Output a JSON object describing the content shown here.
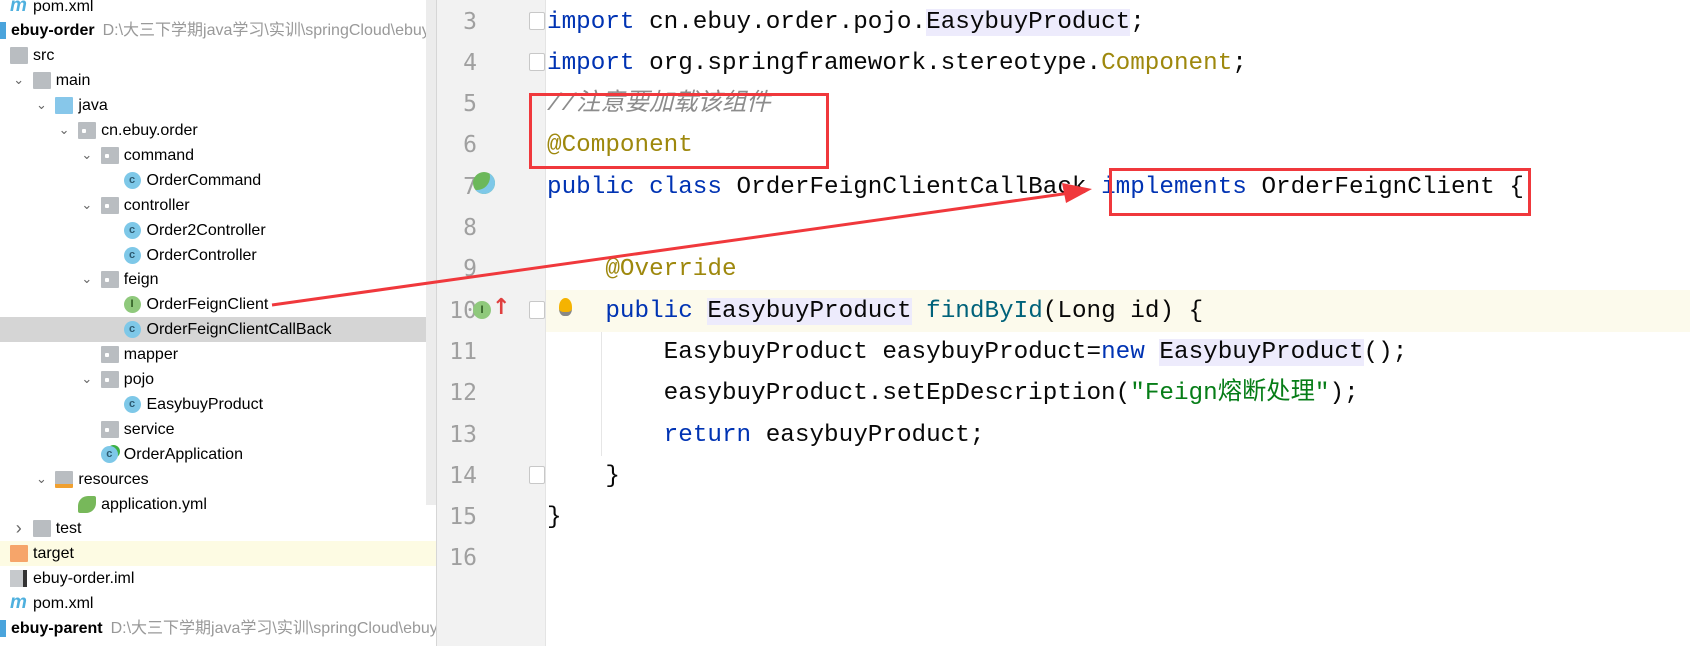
{
  "tree": [
    {
      "label": "pom.xml",
      "icon": "maven-icon",
      "depth": 1
    },
    {
      "label": "ebuy-order",
      "path": "D:\\大三下学期java学习\\实训\\springCloud\\ebuy\\",
      "icon": "module-icon",
      "depth": 0,
      "bold": true
    },
    {
      "label": "src",
      "icon": "folder-icon",
      "depth": 1
    },
    {
      "label": "main",
      "icon": "folder-icon",
      "depth": 2,
      "expanded": true
    },
    {
      "label": "java",
      "icon": "source-folder-icon",
      "depth": 3,
      "expanded": true
    },
    {
      "label": "cn.ebuy.order",
      "icon": "package-icon",
      "depth": 4,
      "expanded": true
    },
    {
      "label": "command",
      "icon": "package-icon",
      "depth": 5,
      "expanded": true
    },
    {
      "label": "OrderCommand",
      "icon": "class-icon",
      "depth": 6
    },
    {
      "label": "controller",
      "icon": "package-icon",
      "depth": 5,
      "expanded": true
    },
    {
      "label": "Order2Controller",
      "icon": "class-icon",
      "depth": 6
    },
    {
      "label": "OrderController",
      "icon": "class-icon",
      "depth": 6
    },
    {
      "label": "feign",
      "icon": "package-icon",
      "depth": 5,
      "expanded": true
    },
    {
      "label": "OrderFeignClient",
      "icon": "interface-icon",
      "depth": 6
    },
    {
      "label": "OrderFeignClientCallBack",
      "icon": "class-icon",
      "depth": 6,
      "selected": true
    },
    {
      "label": "mapper",
      "icon": "package-icon",
      "depth": 5
    },
    {
      "label": "pojo",
      "icon": "package-icon",
      "depth": 5,
      "expanded": true
    },
    {
      "label": "EasybuyProduct",
      "icon": "class-icon",
      "depth": 6
    },
    {
      "label": "service",
      "icon": "package-icon",
      "depth": 5
    },
    {
      "label": "OrderApplication",
      "icon": "spring-boot-class-icon",
      "depth": 5
    },
    {
      "label": "resources",
      "icon": "resources-folder-icon",
      "depth": 3,
      "expanded": true
    },
    {
      "label": "application.yml",
      "icon": "spring-yml-icon",
      "depth": 4
    },
    {
      "label": "test",
      "icon": "folder-icon",
      "depth": 2,
      "expanded": false
    },
    {
      "label": "target",
      "icon": "excluded-folder-icon",
      "depth": 1,
      "excluded": true
    },
    {
      "label": "ebuy-order.iml",
      "icon": "iml-file-icon",
      "depth": 1
    },
    {
      "label": "pom.xml",
      "icon": "maven-icon",
      "depth": 1
    },
    {
      "label": "ebuy-parent",
      "path": "D:\\大三下学期java学习\\实训\\springCloud\\ebuy",
      "icon": "module-icon",
      "depth": 0,
      "bold": true
    }
  ],
  "editor": {
    "current_line": "10",
    "lines": [
      {
        "num": "3",
        "tokens": [
          [
            "import",
            "kw"
          ],
          [
            " cn.ebuy.order.pojo.",
            ""
          ],
          [
            "EasybuyProduct",
            "hl"
          ],
          [
            ";",
            ""
          ]
        ]
      },
      {
        "num": "4",
        "tokens": [
          [
            "import",
            "kw"
          ],
          [
            " org.springframework.stereotype.",
            ""
          ],
          [
            "Component",
            "ann"
          ],
          [
            ";",
            ""
          ]
        ]
      },
      {
        "num": "5",
        "tokens": [
          [
            "//注意要加载该组件",
            "cmt"
          ]
        ]
      },
      {
        "num": "6",
        "tokens": [
          [
            "@Component",
            "ann"
          ]
        ]
      },
      {
        "num": "7",
        "tokens": [
          [
            "public class",
            "kw"
          ],
          [
            " OrderFeignClientCallBack ",
            ""
          ],
          [
            "implements",
            "kw"
          ],
          [
            " OrderFeignClient {",
            ""
          ]
        ]
      },
      {
        "num": "8",
        "tokens": []
      },
      {
        "num": "9",
        "tokens": [
          [
            "    ",
            ""
          ],
          [
            "@Override",
            "ann"
          ]
        ]
      },
      {
        "num": "10",
        "tokens": [
          [
            "    ",
            ""
          ],
          [
            "public",
            "kw"
          ],
          [
            " ",
            ""
          ],
          [
            "EasybuyProduct",
            "hl"
          ],
          [
            " ",
            ""
          ],
          [
            "findById",
            "fn"
          ],
          [
            "(Long id) {",
            ""
          ]
        ]
      },
      {
        "num": "11",
        "tokens": [
          [
            "        EasybuyProduct easybuyProduct=",
            ""
          ],
          [
            "new",
            "kw"
          ],
          [
            " ",
            ""
          ],
          [
            "EasybuyProduct",
            "hl"
          ],
          [
            "();",
            ""
          ]
        ]
      },
      {
        "num": "12",
        "tokens": [
          [
            "        easybuyProduct.setEpDescription(",
            ""
          ],
          [
            "\"Feign熔断处理\"",
            "str"
          ],
          [
            ");",
            ""
          ]
        ]
      },
      {
        "num": "13",
        "tokens": [
          [
            "        ",
            ""
          ],
          [
            "return",
            "kw"
          ],
          [
            " easybuyProduct;",
            ""
          ]
        ]
      },
      {
        "num": "14",
        "tokens": [
          [
            "    }",
            ""
          ]
        ]
      },
      {
        "num": "15",
        "tokens": [
          [
            "}",
            ""
          ]
        ]
      },
      {
        "num": "16",
        "tokens": []
      }
    ]
  },
  "annotations": {
    "color": "#f0383c",
    "arrow_from": "OrderFeignClient",
    "arrow_to": "implements OrderFeignClient"
  },
  "colors": {
    "keyword": "#0033b3",
    "annotation": "#9e880d",
    "comment": "#8c8c8c",
    "string": "#067d17",
    "method": "#00627a",
    "selection": "#d5d5d5"
  }
}
